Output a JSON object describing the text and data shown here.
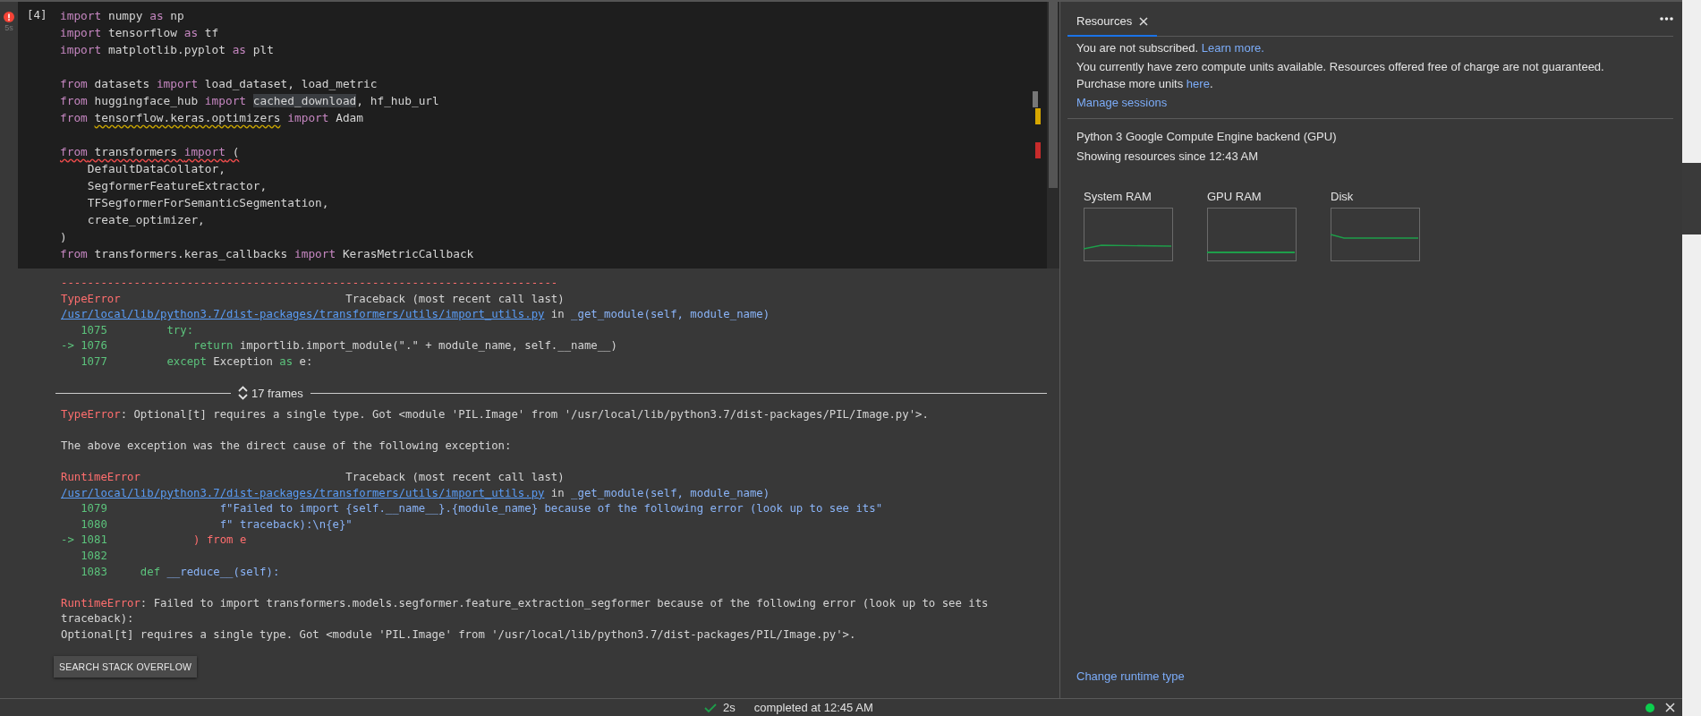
{
  "cell": {
    "execution_count": "[4]",
    "duration": "5s",
    "code_lines": [
      {
        "kind": "code",
        "segments": [
          {
            "kind": "keyword",
            "text": "import"
          },
          {
            "kind": "text",
            "text": " numpy "
          },
          {
            "kind": "keyword",
            "text": "as"
          },
          {
            "kind": "text",
            "text": " np"
          }
        ]
      },
      {
        "kind": "code",
        "segments": [
          {
            "kind": "keyword",
            "text": "import"
          },
          {
            "kind": "text",
            "text": " tensorflow "
          },
          {
            "kind": "keyword",
            "text": "as"
          },
          {
            "kind": "text",
            "text": " tf"
          }
        ]
      },
      {
        "kind": "code",
        "segments": [
          {
            "kind": "keyword",
            "text": "import"
          },
          {
            "kind": "text",
            "text": " matplotlib.pyplot "
          },
          {
            "kind": "keyword",
            "text": "as"
          },
          {
            "kind": "text",
            "text": " plt"
          }
        ]
      },
      {
        "kind": "blank"
      },
      {
        "kind": "code",
        "segments": [
          {
            "kind": "keyword",
            "text": "from"
          },
          {
            "kind": "text",
            "text": " datasets "
          },
          {
            "kind": "keyword",
            "text": "import"
          },
          {
            "kind": "text",
            "text": " load_dataset, load_metric"
          }
        ]
      },
      {
        "kind": "code",
        "segments": [
          {
            "kind": "keyword",
            "text": "from"
          },
          {
            "kind": "text",
            "text": " huggingface_hub "
          },
          {
            "kind": "keyword",
            "text": "import "
          },
          {
            "kind": "highlighted",
            "text": "cached_download"
          },
          {
            "kind": "text",
            "text": ", hf_hub_url"
          }
        ]
      },
      {
        "kind": "code",
        "segments": [
          {
            "kind": "keyword",
            "text": "from "
          },
          {
            "kind": "warning",
            "text": "tensorflow.keras.optimizers"
          },
          {
            "kind": "keyword",
            "text": " import"
          },
          {
            "kind": "text",
            "text": " Adam"
          }
        ]
      },
      {
        "kind": "blank"
      },
      {
        "kind": "code",
        "segments": [
          {
            "kind": "error-keyword",
            "text": "from"
          },
          {
            "kind": "error-text",
            "text": " transformers "
          },
          {
            "kind": "error-keyword",
            "text": "import"
          },
          {
            "kind": "error-text",
            "text": " ("
          }
        ]
      },
      {
        "kind": "code",
        "segments": [
          {
            "kind": "text",
            "text": "    DefaultDataCollator,"
          }
        ]
      },
      {
        "kind": "code",
        "segments": [
          {
            "kind": "text",
            "text": "    SegformerFeatureExtractor,"
          }
        ]
      },
      {
        "kind": "code",
        "segments": [
          {
            "kind": "text",
            "text": "    TFSegformerForSemanticSegmentation,"
          }
        ]
      },
      {
        "kind": "code",
        "segments": [
          {
            "kind": "text",
            "text": "    create_optimizer,"
          }
        ]
      },
      {
        "kind": "code",
        "segments": [
          {
            "kind": "text",
            "text": ")"
          }
        ]
      },
      {
        "kind": "code",
        "segments": [
          {
            "kind": "keyword",
            "text": "from"
          },
          {
            "kind": "text",
            "text": " transformers.keras_callbacks "
          },
          {
            "kind": "keyword",
            "text": "import"
          },
          {
            "kind": "text",
            "text": " KerasMetricCallback"
          }
        ]
      }
    ]
  },
  "output": {
    "lines": [
      {
        "kind": "text",
        "segments": [
          {
            "kind": "red",
            "text": "---------------------------------------------------------------------------"
          }
        ]
      },
      {
        "kind": "text",
        "segments": [
          {
            "kind": "red",
            "text": "TypeError"
          },
          {
            "kind": "text",
            "text": "                                  Traceback (most recent call last)"
          }
        ]
      },
      {
        "kind": "text",
        "segments": [
          {
            "kind": "link",
            "text": "/usr/local/lib/python3.7/dist-packages/transformers/utils/import_utils.py"
          },
          {
            "kind": "text",
            "text": " in "
          },
          {
            "kind": "blue",
            "text": "_get_module(self, module_name)"
          }
        ]
      },
      {
        "kind": "text",
        "segments": [
          {
            "kind": "green",
            "text": "   1075         try:"
          }
        ]
      },
      {
        "kind": "text",
        "segments": [
          {
            "kind": "green",
            "text": "-> 1076             return"
          },
          {
            "kind": "text",
            "text": " importlib.import_module(\".\" + module_name, self.__name__)"
          }
        ]
      },
      {
        "kind": "text",
        "segments": [
          {
            "kind": "green",
            "text": "   1077         except"
          },
          {
            "kind": "text",
            "text": " Exception "
          },
          {
            "kind": "green",
            "text": "as"
          },
          {
            "kind": "text",
            "text": " e:"
          }
        ]
      },
      {
        "kind": "frames",
        "label": "17 frames"
      },
      {
        "kind": "text",
        "segments": [
          {
            "kind": "red",
            "text": "TypeError"
          },
          {
            "kind": "text",
            "text": ": Optional[t] requires a single type. Got <module 'PIL.Image' from '/usr/local/lib/python3.7/dist-packages/PIL/Image.py'>."
          }
        ]
      },
      {
        "kind": "blank"
      },
      {
        "kind": "text",
        "segments": [
          {
            "kind": "text",
            "text": "The above exception was the direct cause of the following exception:"
          }
        ]
      },
      {
        "kind": "blank"
      },
      {
        "kind": "text",
        "segments": [
          {
            "kind": "red",
            "text": "RuntimeError"
          },
          {
            "kind": "text",
            "text": "                               Traceback (most recent call last)"
          }
        ]
      },
      {
        "kind": "text",
        "segments": [
          {
            "kind": "link",
            "text": "/usr/local/lib/python3.7/dist-packages/transformers/utils/import_utils.py"
          },
          {
            "kind": "text",
            "text": " in "
          },
          {
            "kind": "blue",
            "text": "_get_module(self, module_name)"
          }
        ]
      },
      {
        "kind": "text",
        "segments": [
          {
            "kind": "green",
            "text": "   1079"
          },
          {
            "kind": "blue",
            "text": "                 f\"Failed to import {self.__name__}.{module_name} because of the following error (look up to see its\""
          }
        ]
      },
      {
        "kind": "text",
        "segments": [
          {
            "kind": "green",
            "text": "   1080"
          },
          {
            "kind": "blue",
            "text": "                 f\" traceback):\\n{e}\""
          }
        ]
      },
      {
        "kind": "text",
        "segments": [
          {
            "kind": "green",
            "text": "-> 1081"
          },
          {
            "kind": "red",
            "text": "             ) from e"
          }
        ]
      },
      {
        "kind": "text",
        "segments": [
          {
            "kind": "green",
            "text": "   1082"
          }
        ]
      },
      {
        "kind": "text",
        "segments": [
          {
            "kind": "green",
            "text": "   1083     def"
          },
          {
            "kind": "blue",
            "text": " __reduce__(self):"
          }
        ]
      },
      {
        "kind": "blank"
      },
      {
        "kind": "text",
        "segments": [
          {
            "kind": "red",
            "text": "RuntimeError"
          },
          {
            "kind": "text",
            "text": ": Failed to import transformers.models.segformer.feature_extraction_segformer because of the following error (look up to see its traceback):"
          }
        ]
      },
      {
        "kind": "text",
        "segments": [
          {
            "kind": "text",
            "text": "Optional[t] requires a single type. Got <module 'PIL.Image' from '/usr/local/lib/python3.7/dist-packages/PIL/Image.py'>."
          }
        ]
      }
    ],
    "button": "SEARCH STACK OVERFLOW"
  },
  "panel": {
    "tabs": [
      {
        "label": "Resources",
        "selected": true
      }
    ],
    "info": [
      {
        "segments": [
          {
            "kind": "text",
            "text": "You are not subscribed. "
          },
          {
            "kind": "link",
            "text": "Learn more."
          }
        ]
      },
      {
        "segments": [
          {
            "kind": "text",
            "text": "You currently have zero compute units available. Resources offered free of charge are not guaranteed. Purchase more units "
          },
          {
            "kind": "link",
            "text": "here"
          },
          {
            "kind": "text",
            "text": "."
          }
        ]
      }
    ],
    "manage_link": "Manage sessions",
    "backend": "Python 3 Google Compute Engine backend (GPU)",
    "since": "Showing resources since 12:43 AM",
    "charts": [
      {
        "label": "System RAM"
      },
      {
        "label": "GPU RAM"
      },
      {
        "label": "Disk"
      }
    ],
    "runtime_link": "Change runtime type"
  },
  "status_bar": {
    "duration": "2s",
    "message": "completed at 12:45 AM"
  }
}
